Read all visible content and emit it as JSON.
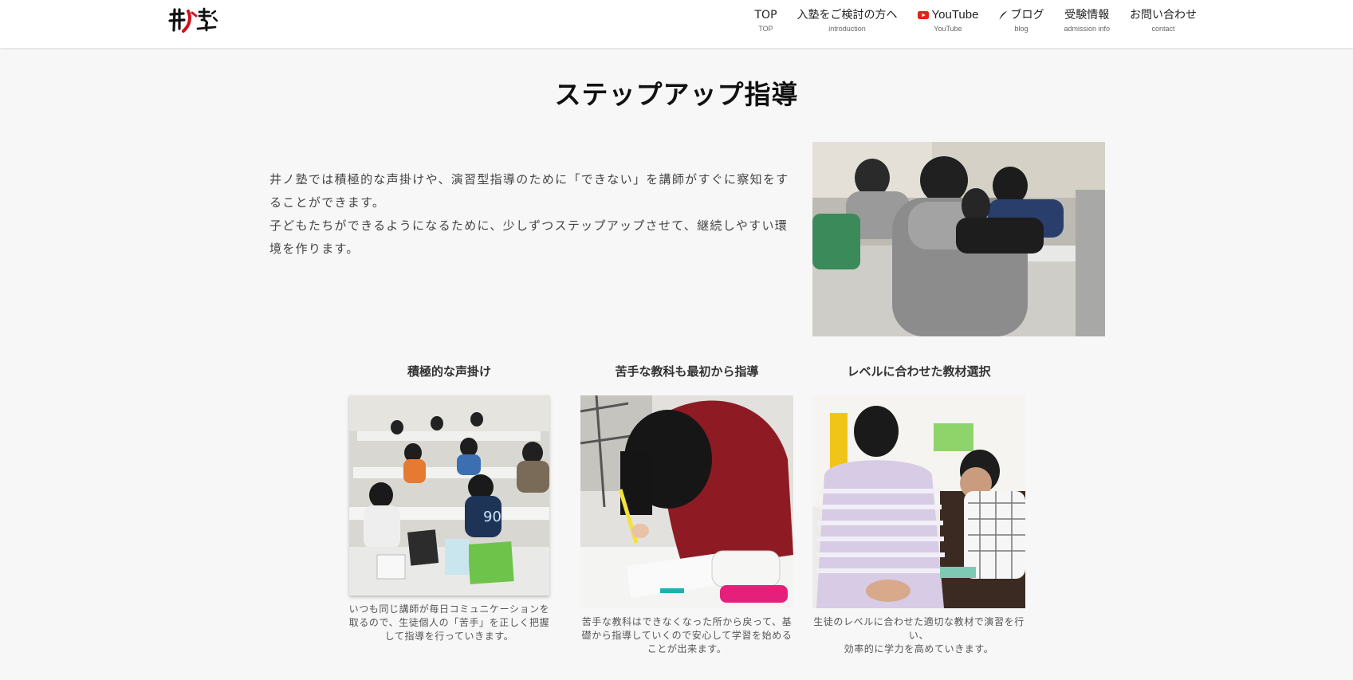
{
  "header": {
    "logo_alt": "井ノ塾",
    "nav": [
      {
        "label": "TOP",
        "sub": "TOP"
      },
      {
        "label": "入塾をご検討の方へ",
        "sub": "introduction"
      },
      {
        "label": "YouTube",
        "sub": "YouTube"
      },
      {
        "label": "ブログ",
        "sub": "blog"
      },
      {
        "label": "受験情報",
        "sub": "admission info"
      },
      {
        "label": "お問い合わせ",
        "sub": "contact"
      }
    ]
  },
  "page": {
    "title": "ステップアップ指導",
    "intro": [
      "井ノ塾では積極的な声掛けや、演習型指導のために「できない」を講師がすぐに察知をすることができます。",
      "子どもたちができるようになるために、少しずつステップアップさせて、継続しやすい環境を作ります。"
    ]
  },
  "features": [
    {
      "title": "積極的な声掛け",
      "desc": "いつも同じ講師が毎日コミュニケーションを取るので、生徒個人の「苦手」を正しく把握して指導を行っていきます。"
    },
    {
      "title": "苦手な教科も最初から指導",
      "desc": "苦手な教科はできなくなった所から戻って、基礎から指導していくので安心して学習を始めることが出来ます。"
    },
    {
      "title": "レベルに合わせた教材選択",
      "desc_line1": "生徒のレベルに合わせた適切な教材で演習を行い、",
      "desc_line2": "効率的に学力を高めていきます。"
    }
  ],
  "colors": {
    "background": "#f7f7f7",
    "header": "#ffffff",
    "youtube_red": "#e62117",
    "logo_red": "#d0121b"
  }
}
